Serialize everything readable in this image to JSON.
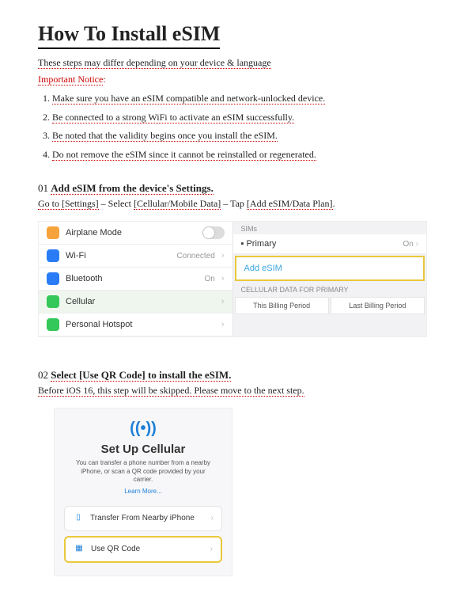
{
  "title": "How To Install eSIM",
  "subtitle": "These steps may differ depending on your device & language",
  "notice_label": "Important Notice",
  "notice_colon": ":",
  "steps": [
    "Make sure you have an eSIM compatible and network-unlocked device.",
    "Be connected to a strong WiFi to activate an eSIM successfully.",
    "Be noted that the validity begins once you install the eSIM.",
    "Do not remove the eSIM since it cannot be reinstalled or regenerated."
  ],
  "section1": {
    "num": "01",
    "title": "Add eSIM from the device's Settings.",
    "sub_prefix": "Go to ",
    "settings": "[Settings]",
    "sep1": " – Select ",
    "cellular": "[Cellular/Mobile Data]",
    "sep2": " – Tap ",
    "addplan": "[Add eSIM/Data Plan]",
    "dot": "."
  },
  "settings_panel": {
    "airplane": "Airplane Mode",
    "wifi": "Wi-Fi",
    "wifi_status": "Connected",
    "bluetooth": "Bluetooth",
    "bluetooth_status": "On",
    "cellular": "Cellular",
    "hotspot": "Personal Hotspot"
  },
  "cellular_panel": {
    "sims_header": "SIMs",
    "primary": "Primary",
    "primary_status": "On",
    "add_esim": "Add eSIM",
    "data_header": "CELLULAR DATA FOR PRIMARY",
    "this_period": "This Billing Period",
    "last_period": "Last Billing Period"
  },
  "section2": {
    "num": "02",
    "title": "Select [Use QR Code] to install the eSIM.",
    "sub": "Before iOS 16, this step will be skipped. Please move to the next step."
  },
  "setup_panel": {
    "heading": "Set Up Cellular",
    "desc": "You can transfer a phone number from a nearby iPhone, or scan a QR code provided by your carrier.",
    "learn": "Learn More...",
    "transfer": "Transfer From Nearby iPhone",
    "useqr": "Use QR Code"
  }
}
